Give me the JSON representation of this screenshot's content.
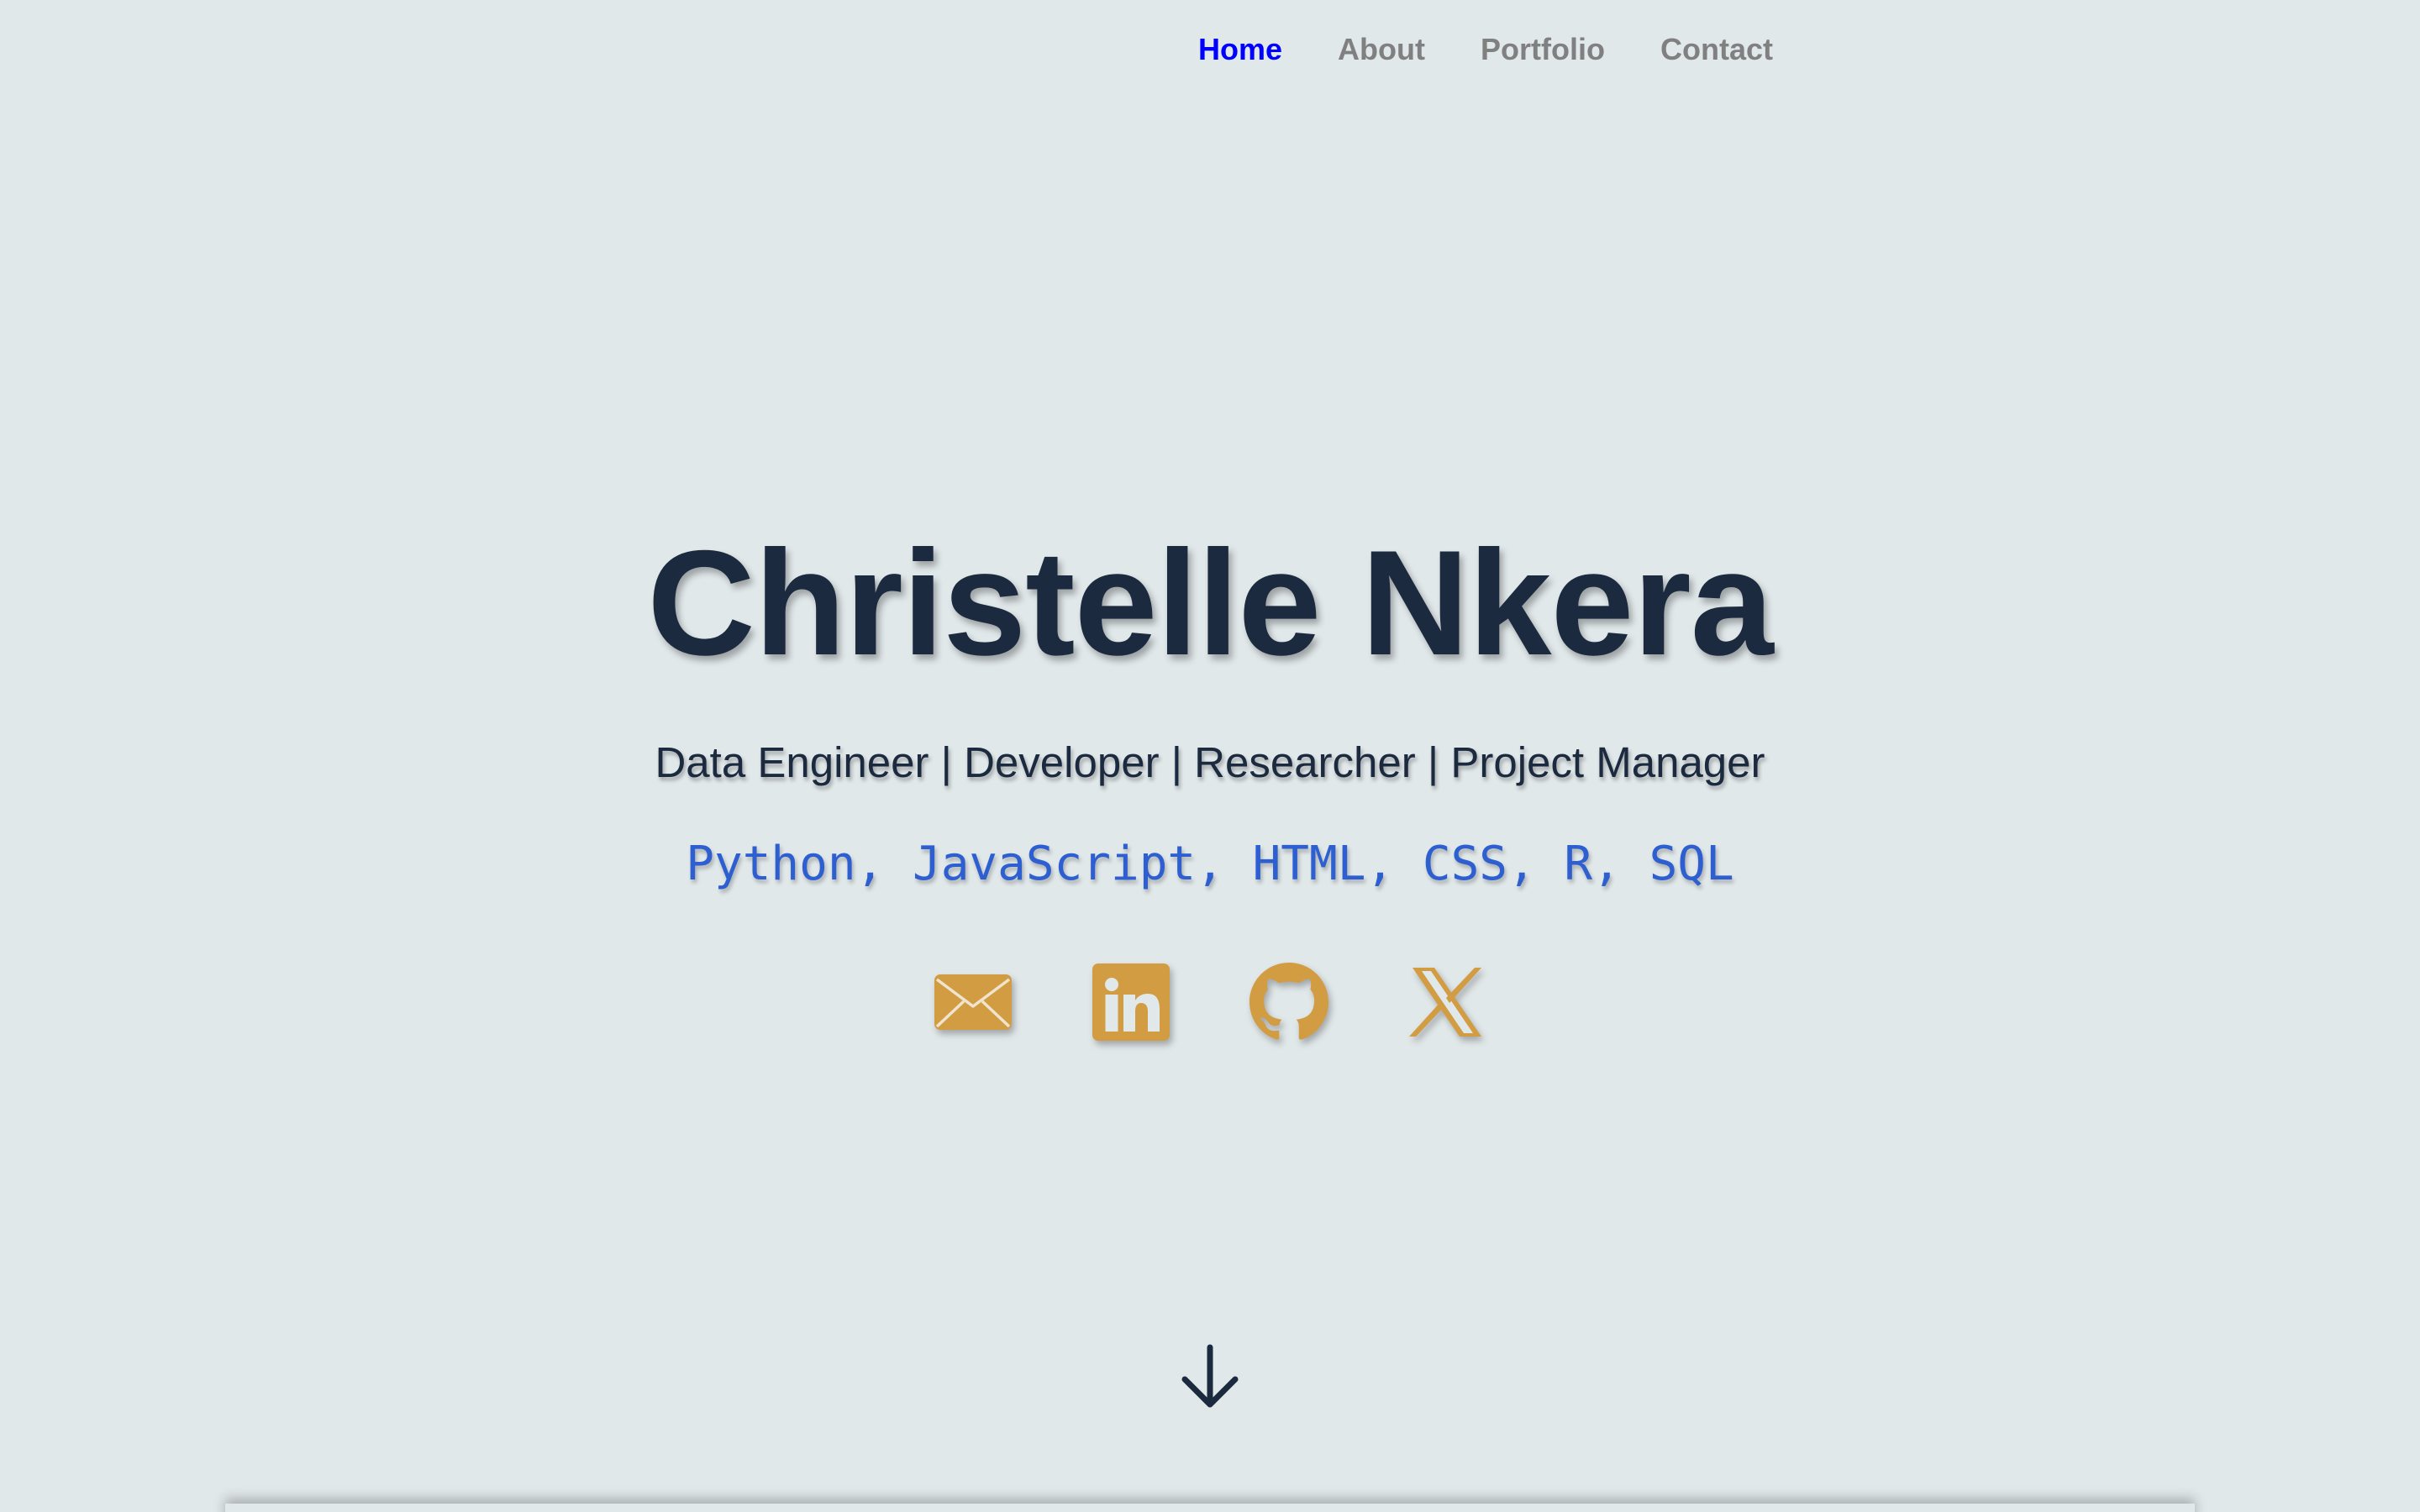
{
  "nav": {
    "items": [
      {
        "label": "Home",
        "active": true
      },
      {
        "label": "About",
        "active": false
      },
      {
        "label": "Portfolio",
        "active": false
      },
      {
        "label": "Contact",
        "active": false
      }
    ]
  },
  "hero": {
    "name": "Christelle Nkera",
    "roles": "Data Engineer | Developer | Researcher | Project Manager",
    "skills": "Python, JavaScript, HTML, CSS, R, SQL"
  },
  "social": {
    "icons": [
      "email-icon",
      "linkedin-icon",
      "github-icon",
      "x-icon"
    ],
    "color": "#d29c42"
  },
  "colors": {
    "background": "#e1e8ea",
    "heading": "#1c2a3f",
    "skills": "#2d5fd1",
    "nav_active": "#0000ff",
    "nav_inactive": "#808080"
  }
}
